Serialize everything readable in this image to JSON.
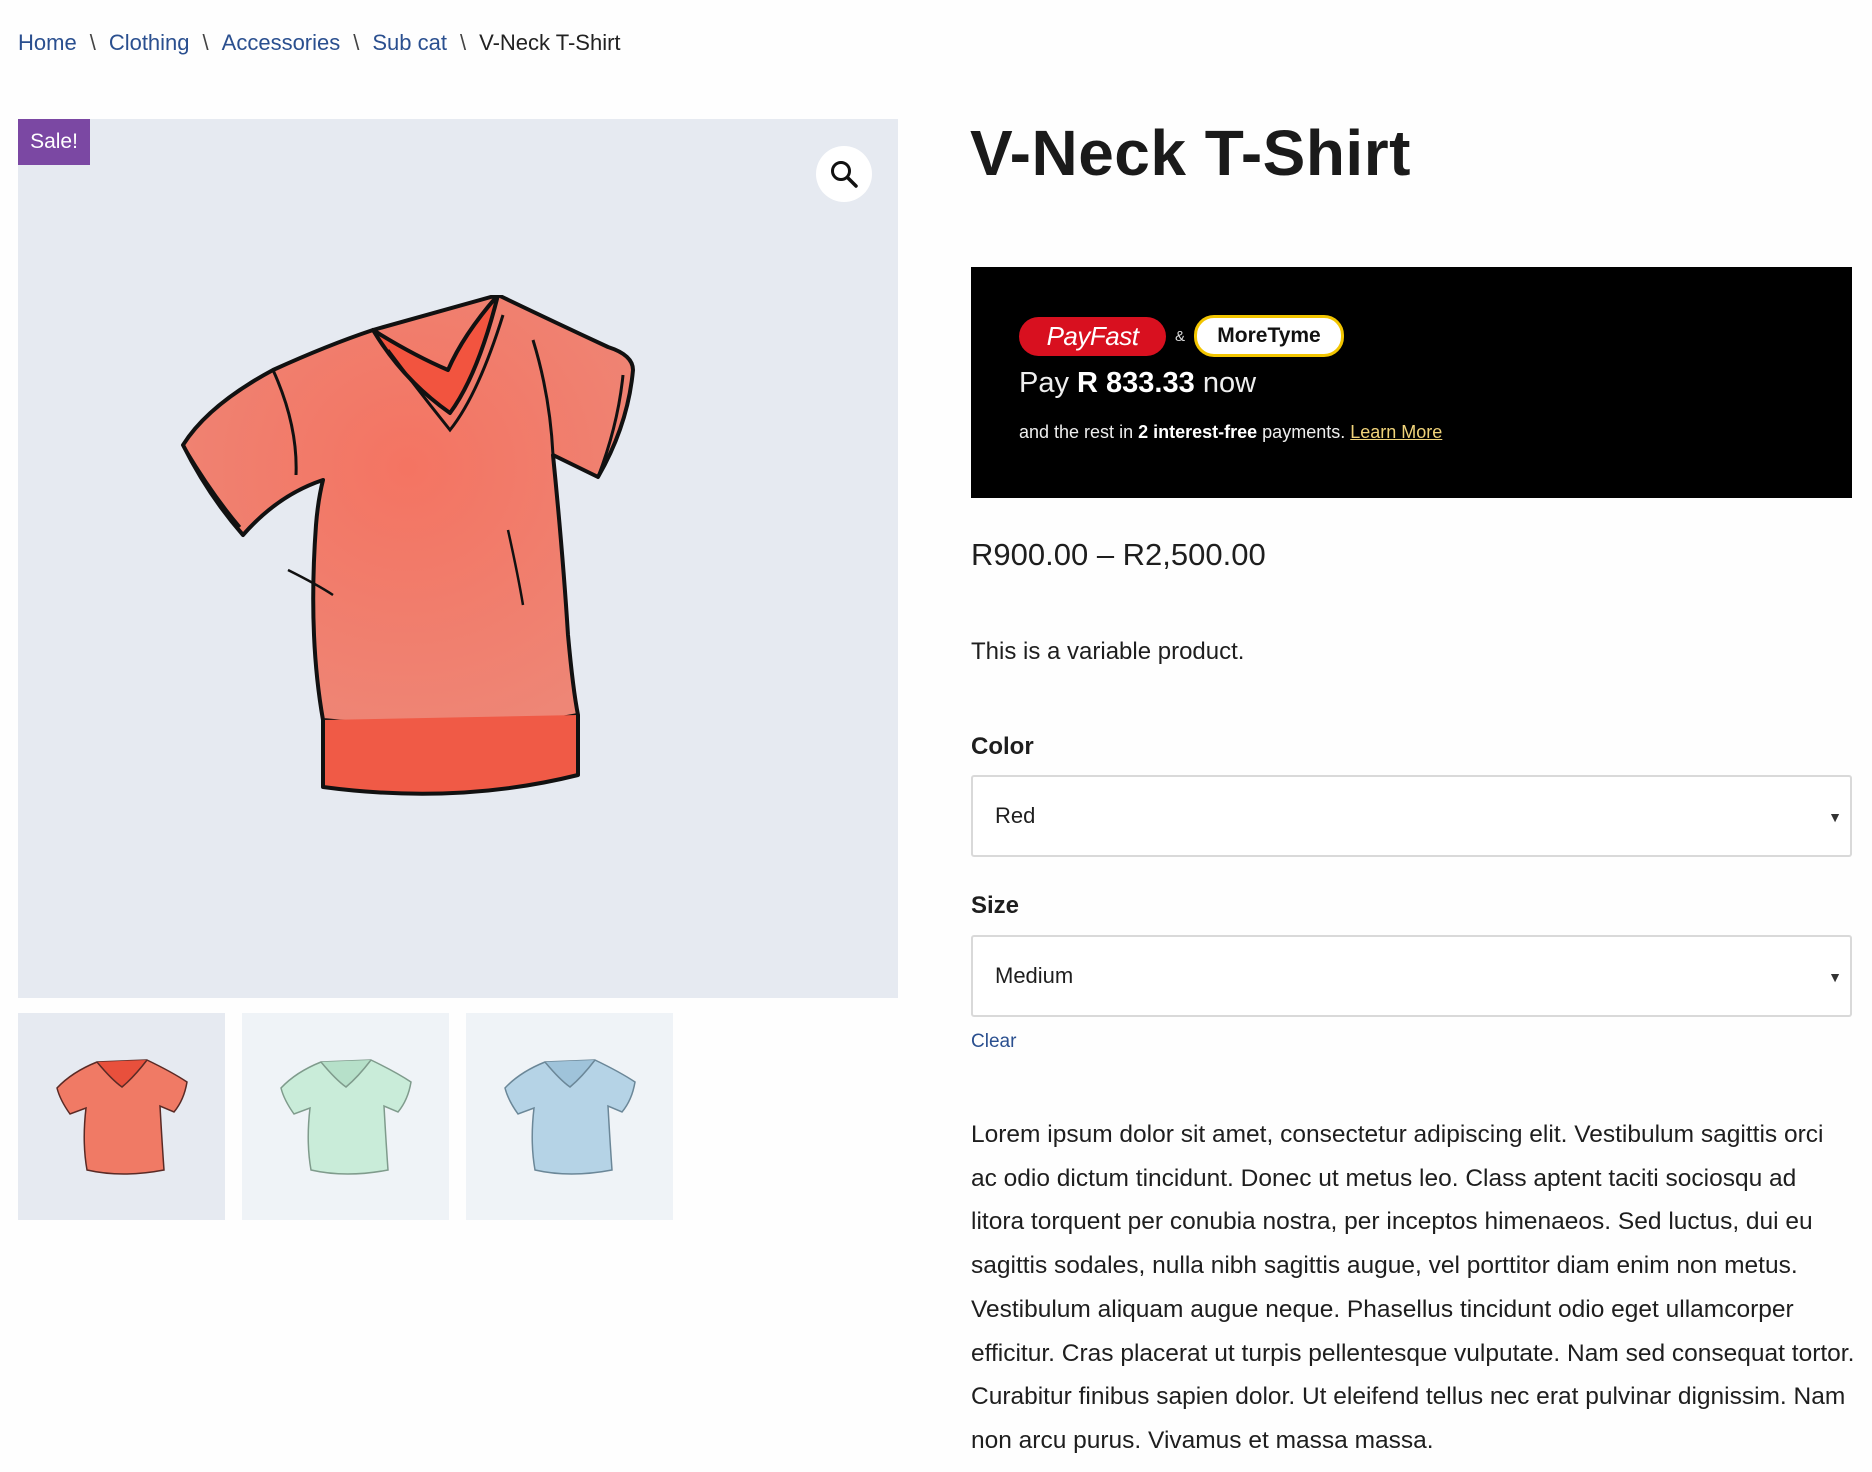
{
  "breadcrumb": {
    "items": [
      "Home",
      "Clothing",
      "Accessories",
      "Sub cat"
    ],
    "separator": "\\",
    "current": "V-Neck T-Shirt"
  },
  "gallery": {
    "sale_badge": "Sale!",
    "zoom_icon": "search-icon",
    "thumbnails": [
      {
        "name": "red shirt",
        "color": "#f07a65"
      },
      {
        "name": "green shirt",
        "color": "#c9ecd9"
      },
      {
        "name": "blue shirt",
        "color": "#b5d3e6"
      }
    ]
  },
  "product": {
    "title": "V-Neck T-Shirt",
    "price_range": "R900.00 – R2,500.00",
    "short_description": "This is a variable product.",
    "long_description": "Lorem ipsum dolor sit amet, consectetur adipiscing elit. Vestibulum sagittis orci ac odio dictum tincidunt. Donec ut metus leo. Class aptent taciti sociosqu ad litora torquent per conubia nostra, per inceptos himenaeos. Sed luctus, dui eu sagittis sodales, nulla nibh sagittis augue, vel porttitor diam enim non metus. Vestibulum aliquam augue neque. Phasellus tincidunt odio eget ullamcorper efficitur. Cras placerat ut turpis pellentesque vulputate. Nam sed consequat tortor. Curabitur finibus sapien dolor. Ut eleifend tellus nec erat pulvinar dignissim. Nam non arcu purus. Vivamus et massa massa."
  },
  "payment_banner": {
    "payfast_logo": "PayFast",
    "ampersand": "&",
    "moretyme_logo": "MoreTyme",
    "pay_prefix": "Pay",
    "pay_amount": "R 833.33",
    "pay_suffix": "now",
    "rest_prefix": "and the rest in",
    "rest_bold": "2 interest-free",
    "rest_suffix": "payments.",
    "learn_more": "Learn More"
  },
  "variations": {
    "color_label": "Color",
    "color_value": "Red",
    "size_label": "Size",
    "size_value": "Medium",
    "clear_label": "Clear"
  },
  "colors": {
    "link": "#2a4f8f",
    "sale_badge": "#7b48a3",
    "payfast_red": "#d8101f",
    "moretyme_yellow": "#f2c500",
    "image_bg": "#e6eaf1"
  }
}
